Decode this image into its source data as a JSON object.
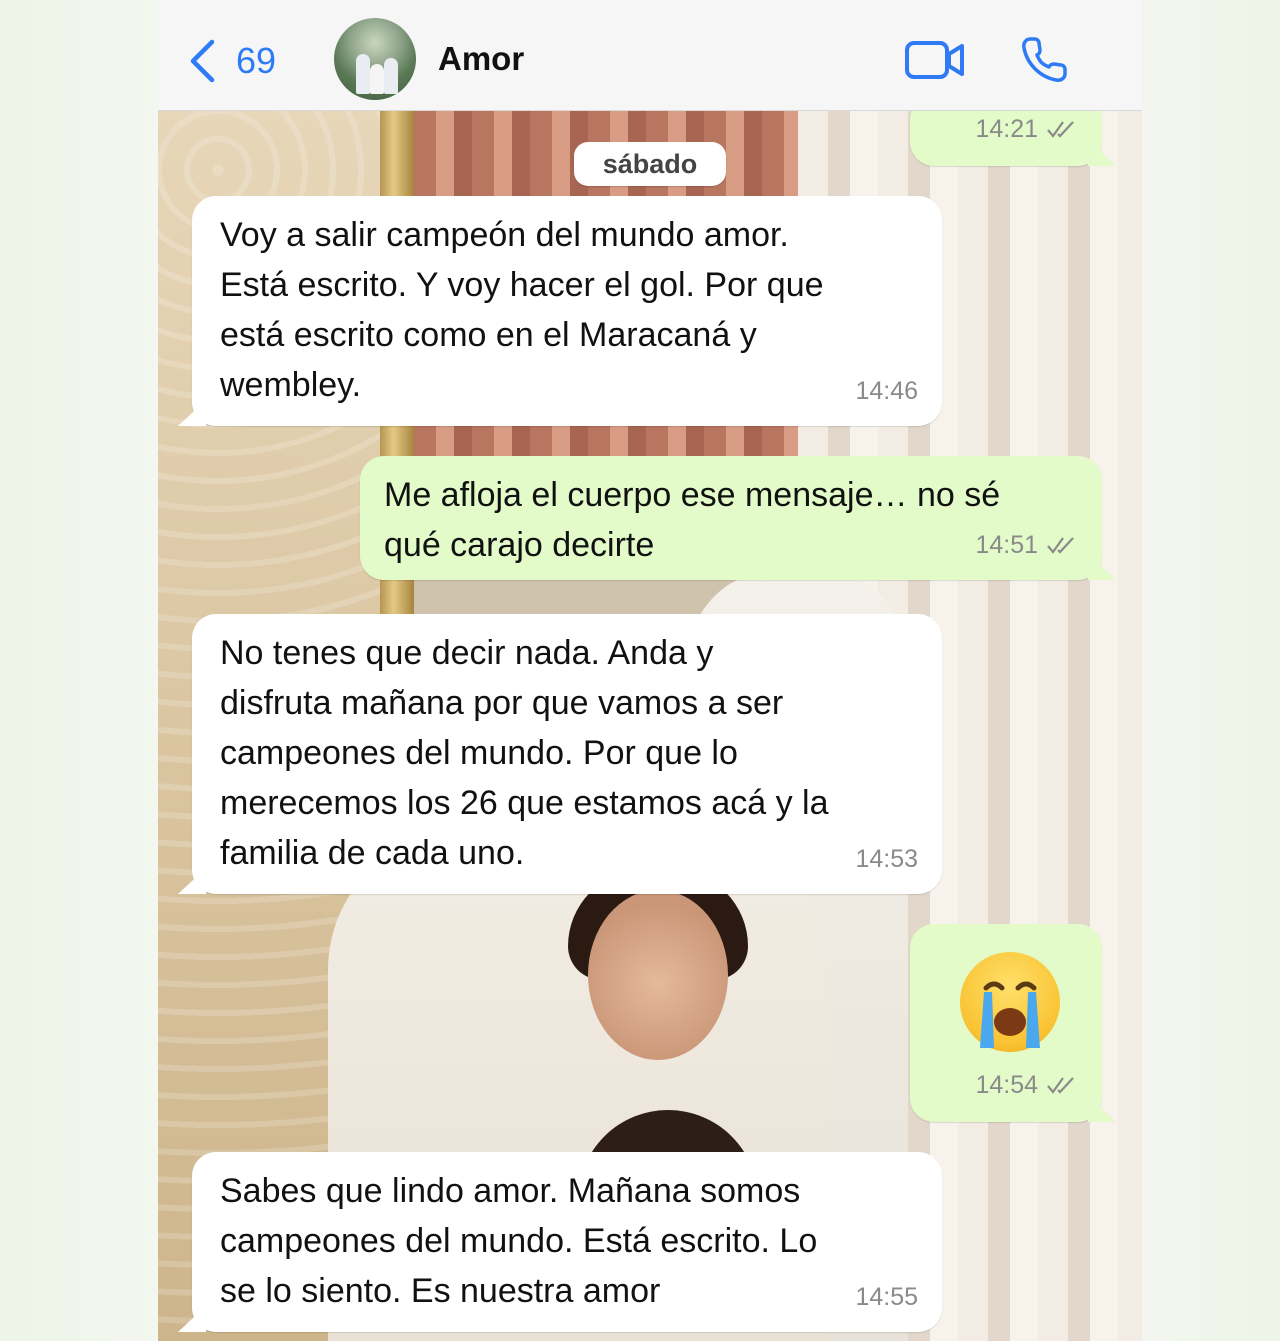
{
  "header": {
    "back_count": "69",
    "contact_name": "Amor",
    "back_icon": "chevron-left-icon",
    "video_icon": "video-camera-icon",
    "call_icon": "phone-icon",
    "accent_color": "#2f7bf6"
  },
  "chat": {
    "date_separator": "sábado",
    "messages": [
      {
        "direction": "out",
        "text": "",
        "time": "14:21",
        "read": true
      },
      {
        "direction": "in",
        "text": "Voy a salir campeón del mundo amor.\nEstá escrito. Y voy hacer el gol. Por que\nestá escrito como en el Maracaná y\nwembley.",
        "time": "14:46"
      },
      {
        "direction": "out",
        "text": "Me afloja el cuerpo ese mensaje… no sé\nqué carajo decirte",
        "time": "14:51",
        "read": true
      },
      {
        "direction": "in",
        "text": "No tenes que decir nada. Anda y\ndisfruta mañana por que vamos a ser\ncampeones del mundo. Por que lo\nmerecemos los 26 que estamos acá y la\nfamilia de cada uno.",
        "time": "14:53"
      },
      {
        "direction": "out",
        "emoji": "crying-face",
        "time": "14:54",
        "read": true
      },
      {
        "direction": "in",
        "text": "Sabes que lindo amor. Mañana somos\ncampeones del mundo. Está escrito. Lo\nse lo siento.  Es nuestra amor",
        "time": "14:55"
      }
    ]
  },
  "colors": {
    "incoming_bubble": "#ffffff",
    "outgoing_bubble": "#e2fbc9",
    "read_ticks": "#8a8a8a"
  }
}
